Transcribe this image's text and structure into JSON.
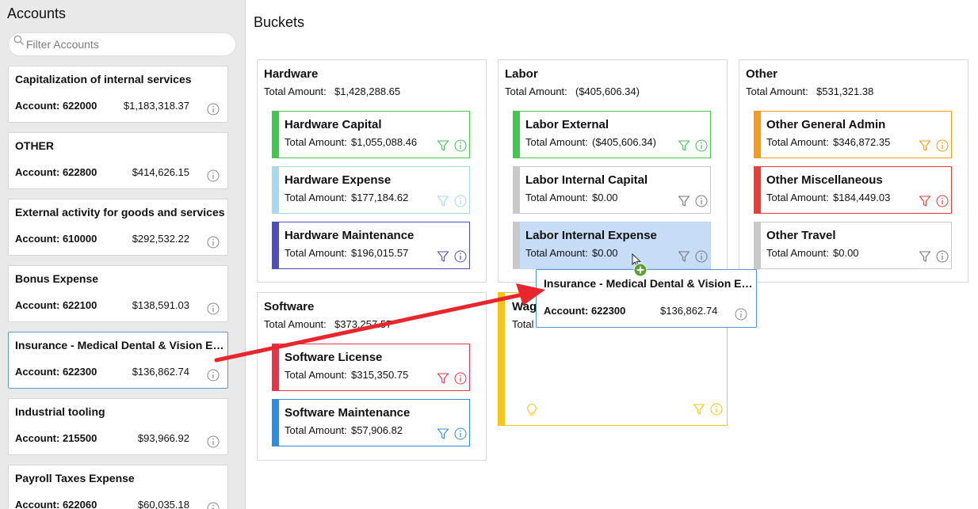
{
  "sidebar": {
    "title": "Accounts",
    "filter_placeholder": "Filter Accounts",
    "accounts": [
      {
        "name": "Capitalization of internal services",
        "account": "Account: 622000",
        "amount": "$1,183,318.37"
      },
      {
        "name": "OTHER",
        "account": "Account: 622800",
        "amount": "$414,626.15"
      },
      {
        "name": "External activity for goods and services",
        "account": "Account: 610000",
        "amount": "$292,532.22"
      },
      {
        "name": "Bonus Expense",
        "account": "Account: 622100",
        "amount": "$138,591.03"
      },
      {
        "name": "Insurance - Medical Dental & Vision Expense",
        "account": "Account: 622300",
        "amount": "$136,862.74"
      },
      {
        "name": "Industrial tooling",
        "account": "Account: 215500",
        "amount": "$93,966.92"
      },
      {
        "name": "Payroll Taxes Expense",
        "account": "Account: 622060",
        "amount": "$60,035.18"
      }
    ]
  },
  "main": {
    "title": "Buckets",
    "total_label": "Total Amount:",
    "groups": {
      "hardware": {
        "name": "Hardware",
        "total": "$1,428,288.65",
        "buckets": [
          {
            "name": "Hardware Capital",
            "total": "$1,055,088.46",
            "color": "#44c552"
          },
          {
            "name": "Hardware Expense",
            "total": "$177,184.62",
            "color": "#a6d8f0"
          },
          {
            "name": "Hardware Maintenance",
            "total": "$196,015.57",
            "color": "#4d4fc0"
          }
        ]
      },
      "labor": {
        "name": "Labor",
        "total": "($405,606.34)",
        "buckets": [
          {
            "name": "Labor External",
            "total": "($405,606.34)",
            "color": "#44c552"
          },
          {
            "name": "Labor Internal Capital",
            "total": "$0.00",
            "color": "#c9c9c9"
          },
          {
            "name": "Labor Internal Expense",
            "total": "$0.00",
            "color": "#c9c9c9"
          }
        ]
      },
      "other": {
        "name": "Other",
        "total": "$531,321.38",
        "buckets": [
          {
            "name": "Other General Admin",
            "total": "$346,872.35",
            "color": "#f79a22"
          },
          {
            "name": "Other Miscellaneous",
            "total": "$184,449.03",
            "color": "#ee3b36"
          },
          {
            "name": "Other Travel",
            "total": "$0.00",
            "color": "#c9c9c9"
          }
        ]
      },
      "software": {
        "name": "Software",
        "total": "$373,257.57",
        "buckets": [
          {
            "name": "Software License",
            "total": "$315,350.75",
            "color": "#e8344a"
          },
          {
            "name": "Software Maintenance",
            "total": "$57,906.82",
            "color": "#2d8de6"
          }
        ]
      },
      "wages": {
        "name": "Wag",
        "total_label_partial": "Total",
        "color": "#f5c518"
      }
    }
  },
  "drag_card": {
    "name": "Insurance - Medical Dental & Vision Expense",
    "account": "Account: 622300",
    "amount": "$136,862.74"
  },
  "colors": {
    "accent_blue": "#5b9bd5",
    "drag_arrow": "#e8262b",
    "drop_plus": "#5aa02c",
    "wages_yellow": "#f5c518"
  },
  "icons": [
    "search-icon",
    "info-icon",
    "filter-icon",
    "lightbulb-icon",
    "add-icon",
    "cursor-icon",
    "arrow-icon"
  ]
}
